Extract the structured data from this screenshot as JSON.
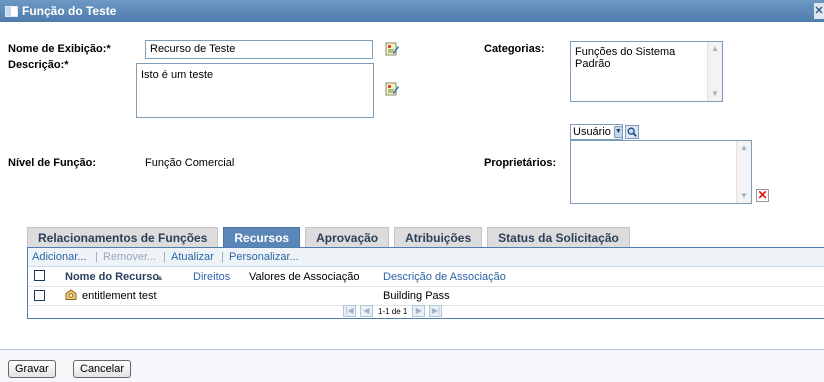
{
  "window": {
    "title": "Função do Teste"
  },
  "form": {
    "display_name_label": "Nome de Exibição:*",
    "display_name_value": "Recurso de Teste",
    "description_label": "Descrição:*",
    "description_value": "Isto é um teste",
    "categories_label": "Categorias:",
    "categories_options": [
      "Funções do Sistema",
      "Padrão"
    ],
    "role_level_label": "Nível de Função:",
    "role_level_value": "Função Comercial",
    "owners_label": "Proprietários:",
    "owner_type_value": "Usuário"
  },
  "tabs": [
    {
      "label": "Relacionamentos de Funções",
      "active": false
    },
    {
      "label": "Recursos",
      "active": true
    },
    {
      "label": "Aprovação",
      "active": false
    },
    {
      "label": "Atribuições",
      "active": false
    },
    {
      "label": "Status da Solicitação",
      "active": false
    }
  ],
  "toolbar": {
    "add": "Adicionar...",
    "remove": "Remover...",
    "refresh": "Atualizar",
    "customize": "Personalizar..."
  },
  "table": {
    "columns": {
      "resource_name": "Nome do Recurso",
      "sort_indicator": "▲",
      "rights": "Direitos",
      "assoc_values": "Valores de Associação",
      "assoc_description": "Descrição de Associação"
    },
    "rows": [
      {
        "resource_name": "entitlement test",
        "rights": "",
        "assoc_values": "",
        "assoc_description": "Building Pass"
      }
    ],
    "pager": {
      "text": "1-1 de 1"
    }
  },
  "buttons": {
    "save": "Gravar",
    "cancel": "Cancelar"
  },
  "colors": {
    "title_bar": "#5683b3",
    "active_tab": "#5b87b8",
    "link": "#2d64a6"
  }
}
